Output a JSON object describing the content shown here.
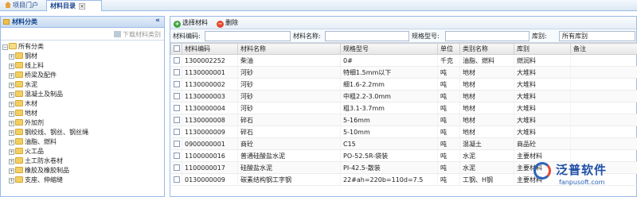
{
  "tabs": [
    {
      "label": "项目门户"
    },
    {
      "label": "材料目录"
    }
  ],
  "left": {
    "title": "材料分类",
    "download_label": "下载材料类别",
    "root": "所有分类",
    "categories": [
      "钢材",
      "线上料",
      "桥梁及配件",
      "水泥",
      "混凝土及制品",
      "木材",
      "地材",
      "外加剂",
      "钢绞线、钢丝、钢丝绳",
      "油脂、燃料",
      "火工品",
      "土工防水卷材",
      "橡胶及橡胶制品",
      "支座、伸缩缝"
    ]
  },
  "toolbar": {
    "add_label": "选择材料",
    "delete_label": "删除"
  },
  "filter": {
    "code_label": "材料编码:",
    "name_label": "材料名称:",
    "spec_label": "规格型号:",
    "warehouse_label": "库别:",
    "warehouse_value": "所有库别"
  },
  "grid": {
    "columns": [
      "材料编码",
      "材料名称",
      "规格型号",
      "单位",
      "类别名称",
      "库别",
      "备注"
    ],
    "rows": [
      [
        "1300002252",
        "柴油",
        "0#",
        "千克",
        "油脂、燃料",
        "燃润料",
        ""
      ],
      [
        "1130000001",
        "河砂",
        "特细1.5mm以下",
        "吨",
        "地材",
        "大堆料",
        ""
      ],
      [
        "1130000002",
        "河砂",
        "细1.6-2.2mm",
        "吨",
        "地材",
        "大堆料",
        ""
      ],
      [
        "1130000003",
        "河砂",
        "中粗2.2-3.0mm",
        "吨",
        "地材",
        "大堆料",
        ""
      ],
      [
        "1130000004",
        "河砂",
        "粗3.1-3.7mm",
        "吨",
        "地材",
        "大堆料",
        ""
      ],
      [
        "1130000008",
        "碎石",
        "5-16mm",
        "吨",
        "地材",
        "大堆料",
        ""
      ],
      [
        "1130000009",
        "碎石",
        "5-10mm",
        "吨",
        "地材",
        "大堆料",
        ""
      ],
      [
        "0900000001",
        "商砼",
        "C15",
        "吨",
        "混凝土",
        "商品砼",
        ""
      ],
      [
        "1100000016",
        "普通硅酸盐水泥",
        "PO-52.5R-袋装",
        "吨",
        "水泥",
        "主要材料",
        ""
      ],
      [
        "1100000017",
        "硅酸盐水泥",
        "PI-42.5-散装",
        "吨",
        "水泥",
        "主要材料",
        ""
      ],
      [
        "0130000009",
        "碳素结构钢工字钢",
        "22#ah=220b=110d=7.5",
        "吨",
        "工钢、H钢",
        "主要材料",
        ""
      ]
    ]
  },
  "watermark": {
    "brand": "泛普软件",
    "url": "fanpusoft.com"
  }
}
